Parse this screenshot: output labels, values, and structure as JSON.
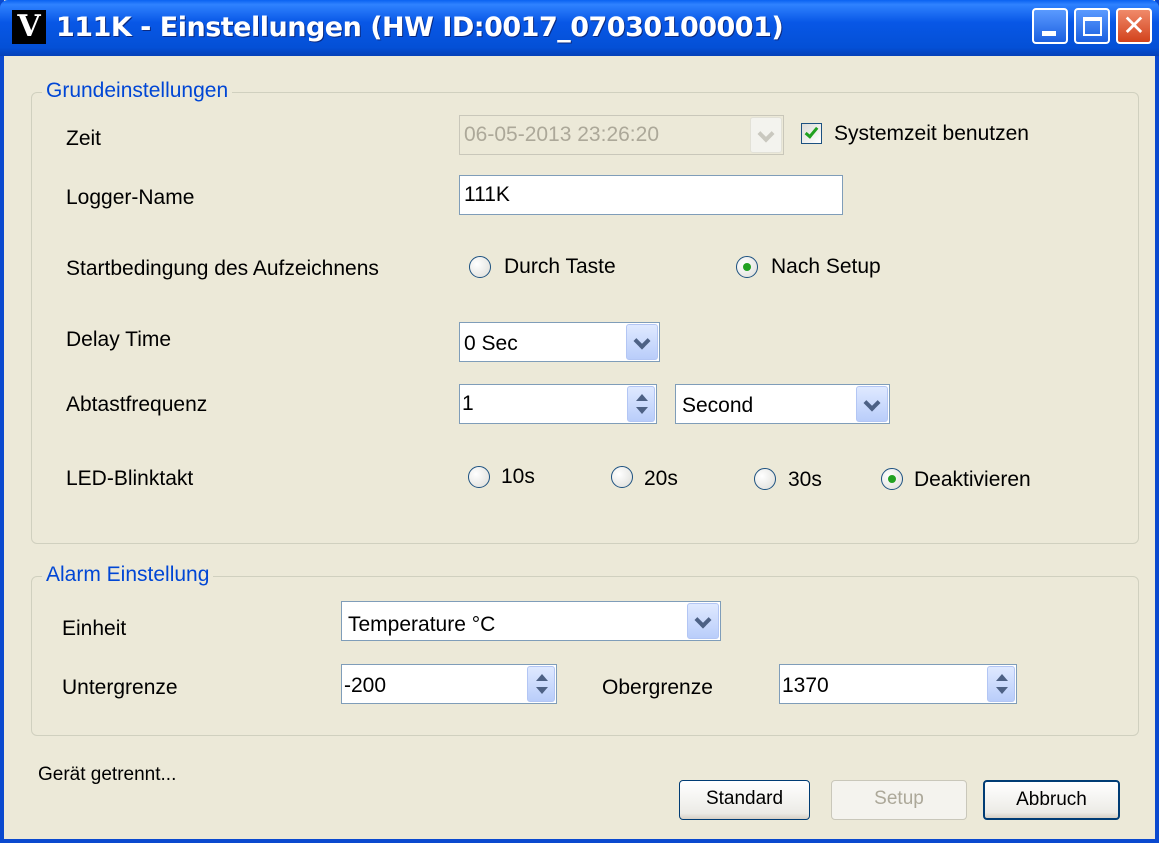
{
  "window": {
    "app_icon": "V",
    "title": "111K - Einstellungen (HW ID:0017_07030100001)",
    "controls": {
      "minimize": "minimize-icon",
      "maximize": "maximize-icon",
      "close_glyph": "✕"
    }
  },
  "basic_settings": {
    "group_title": "Grundeinstellungen",
    "time_label": "Zeit",
    "time_value": "06-05-2013 23:26:20",
    "system_time_label": "Systemzeit benutzen",
    "system_time_checked": true,
    "logger_name_label": "Logger-Name",
    "logger_name_value": "111K",
    "start_condition_label": "Startbedingung des Aufzeichnens",
    "start_options": [
      {
        "label": "Durch Taste",
        "selected": false
      },
      {
        "label": "Nach Setup",
        "selected": true
      }
    ],
    "delay_label": "Delay Time",
    "delay_value": "0 Sec",
    "sample_label": "Abtastfrequenz",
    "sample_value": "1",
    "sample_unit": "Second",
    "led_label": "LED-Blinktakt",
    "led_options": [
      {
        "label": "10s",
        "selected": false
      },
      {
        "label": "20s",
        "selected": false
      },
      {
        "label": "30s",
        "selected": false
      },
      {
        "label": "Deaktivieren",
        "selected": true
      }
    ]
  },
  "alarm_settings": {
    "group_title": "Alarm Einstellung",
    "unit_label": "Einheit",
    "unit_value": "Temperature °C",
    "lower_label": "Untergrenze",
    "lower_value": "-200",
    "upper_label": "Obergrenze",
    "upper_value": "1370"
  },
  "footer": {
    "status": "Gerät getrennt...",
    "buttons": {
      "standard": "Standard",
      "setup": "Setup",
      "cancel": "Abbruch"
    }
  },
  "colors": {
    "accent": "#0046d5",
    "titlebar": "#0857e6",
    "check": "#21a121",
    "face": "#ece9d8"
  }
}
